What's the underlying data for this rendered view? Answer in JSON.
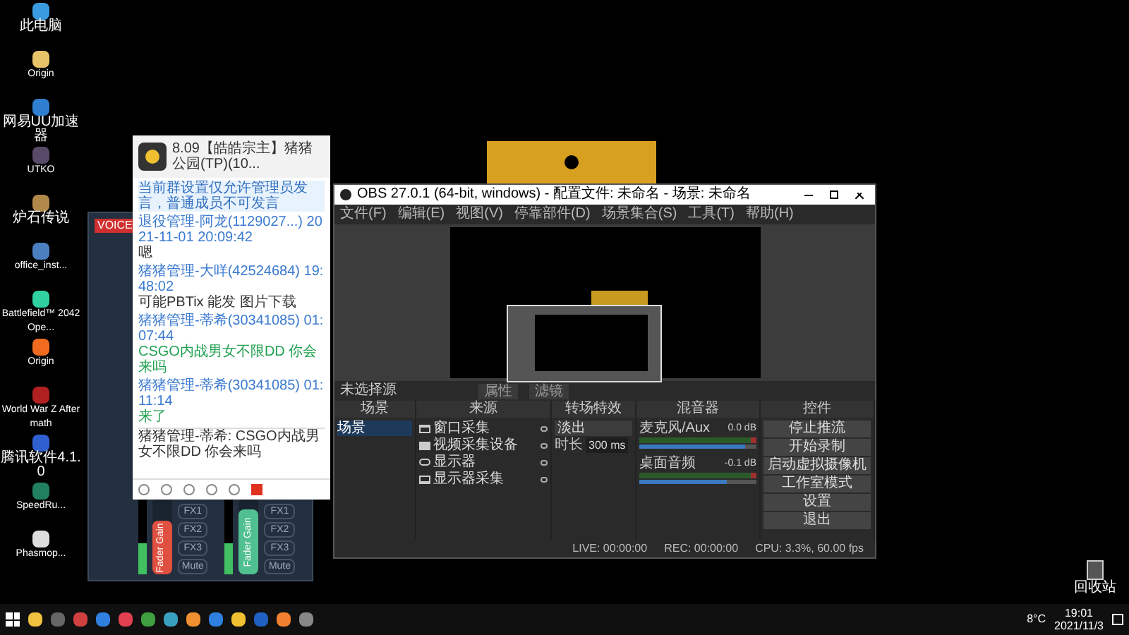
{
  "desktop_icons": [
    {
      "label": "此电脑",
      "color": "#3b9be0"
    },
    {
      "label": "Origin",
      "color": "#e8c36a"
    },
    {
      "label": "网易UU加速器",
      "color": "#2f7fd0"
    },
    {
      "label": "UTKO",
      "color": "#5a4a6a"
    },
    {
      "label": "炉石传说",
      "color": "#b0884a"
    },
    {
      "label": "office_inst...",
      "color": "#4a7fc0"
    },
    {
      "label": "Battlefield™ 2042 Ope...",
      "color": "#30d0a0"
    },
    {
      "label": "Origin",
      "color": "#f06a20"
    },
    {
      "label": "World War Z Aftermath",
      "color": "#b02020"
    },
    {
      "label": "腾讯软件4.1.0",
      "color": "#3060d0"
    },
    {
      "label": "SpeedRu...",
      "color": "#208060"
    },
    {
      "label": "Phasmop...",
      "color": "#dddddd"
    }
  ],
  "recycle_bin": {
    "label": "回收站"
  },
  "mixer_panel": {
    "badge": "VOICE",
    "channels": [
      {
        "fader_label": "Fader Gain",
        "color": "#e05040",
        "level": 0.7,
        "buttons": [
          "FX1",
          "FX2",
          "FX3",
          "Mute"
        ]
      },
      {
        "fader_label": "Fader Gain",
        "color": "#50c090",
        "level": 0.85,
        "buttons": [
          "FX1",
          "FX2",
          "FX3",
          "Mute"
        ]
      }
    ]
  },
  "chat_window": {
    "title": "8.09【皓皓宗主】猪猪公园(TP)(10...",
    "messages": [
      {
        "kind": "notice",
        "text": "当前群设置仅允许管理员发言，普通成员不可发言"
      },
      {
        "kind": "message",
        "sender": "退役管理-阿龙(1129027...) 2021-11-01 20:09:42",
        "text": "嗯",
        "highlight": false
      },
      {
        "kind": "message",
        "sender": "猪猪管理-大咩(42524684) 19:48:02",
        "text": "可能PBTix 能发 图片下载",
        "highlight": false
      },
      {
        "kind": "message",
        "sender": "猪猪管理-蒂希(30341085) 01:07:44",
        "text": "CSGO内战男女不限DD 你会来吗",
        "highlight": true
      },
      {
        "kind": "message",
        "sender": "猪猪管理-蒂希(30341085) 01:11:14",
        "text": "来了",
        "highlight": true
      },
      {
        "kind": "preview",
        "text": "猪猪管理-蒂希: CSGO内战男女不限DD 你会来吗"
      }
    ]
  },
  "obs": {
    "title": "OBS 27.0.1 (64-bit, windows) - 配置文件: 未命名 - 场景: 未命名",
    "menu": [
      "文件(F)",
      "编辑(E)",
      "视图(V)",
      "停靠部件(D)",
      "场景集合(S)",
      "工具(T)",
      "帮助(H)"
    ],
    "source_bar": {
      "label": "未选择源",
      "buttons": [
        "属性",
        "滤镜"
      ]
    },
    "docks": {
      "scenes": {
        "title": "场景",
        "items": [
          {
            "label": "场景",
            "selected": true
          }
        ]
      },
      "sources": {
        "title": "来源",
        "items": [
          {
            "label": "窗口采集",
            "kind": "window"
          },
          {
            "label": "视频采集设备",
            "kind": "camera"
          },
          {
            "label": "显示器",
            "kind": "eye"
          },
          {
            "label": "显示器采集",
            "kind": "monitor"
          }
        ]
      },
      "transitions": {
        "title": "转场特效",
        "value": "淡出",
        "duration_label": "时长",
        "duration": "300 ms"
      },
      "mixer": {
        "title": "混音器",
        "channels": [
          {
            "name": "麦克风/Aux",
            "reading": "0.0 dB",
            "level": 0.9
          },
          {
            "name": "桌面音频",
            "reading": "-0.1 dB",
            "level": 0.75
          }
        ]
      },
      "controls": {
        "title": "控件",
        "buttons": [
          "停止推流",
          "开始录制",
          "启动虚拟摄像机",
          "工作室模式",
          "设置",
          "退出"
        ]
      }
    },
    "status_bar": [
      "LIVE: 00:00:00",
      "REC: 00:00:00",
      "CPU: 3.3%, 60.00 fps"
    ]
  },
  "taskbar": {
    "apps": [
      {
        "color": "#f0c040"
      },
      {
        "color": "#666666"
      },
      {
        "color": "#d04040"
      },
      {
        "color": "#3080e0"
      },
      {
        "color": "#e04050"
      },
      {
        "color": "#40a040"
      },
      {
        "color": "#3aa0c0"
      },
      {
        "color": "#f09030"
      },
      {
        "color": "#3080e0"
      },
      {
        "color": "#f0c030"
      },
      {
        "color": "#2060c0"
      },
      {
        "color": "#f08030"
      },
      {
        "color": "#888888"
      }
    ],
    "weather": "8°C",
    "time": "19:01",
    "date": "2021/11/3"
  }
}
